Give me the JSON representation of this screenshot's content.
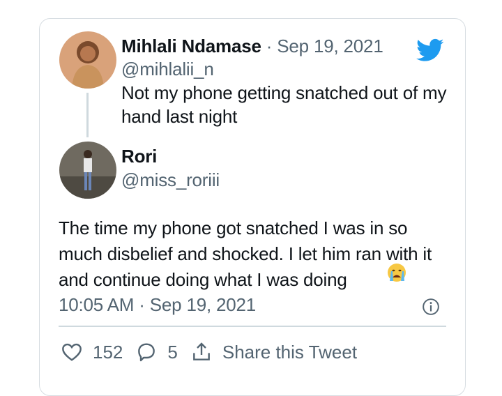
{
  "quoted_tweet": {
    "author_name": "Mihlali Ndamase",
    "separator": "·",
    "date": "Sep 19, 2021",
    "handle": "@mihlalii_n",
    "text": "Not my phone getting snatched out of my hand last night"
  },
  "tweet": {
    "author_name": "Rori",
    "handle": "@miss_roriii",
    "text": "The time my phone got snatched I was in so much disbelief and shocked. I let him ran with it and continue doing what I was doing",
    "time": "10:05 AM · Sep 19, 2021"
  },
  "actions": {
    "likes": "152",
    "replies": "5",
    "share_label": "Share this Tweet"
  },
  "icons": {
    "brand": "twitter-bird-icon",
    "info": "info-icon",
    "like": "heart-icon",
    "reply": "reply-icon",
    "share": "share-icon",
    "emoji": "crying-face-emoji"
  },
  "colors": {
    "twitter_blue": "#1d9bf0",
    "muted_text": "#536471",
    "border": "#d7dde2"
  }
}
